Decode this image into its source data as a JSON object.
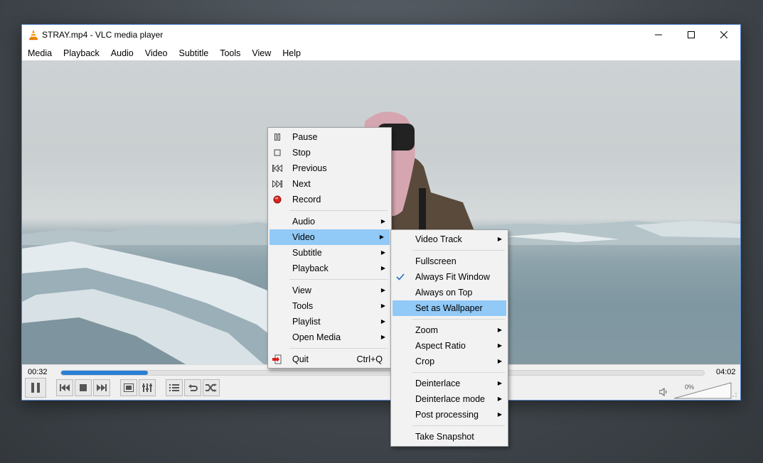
{
  "window": {
    "title": "STRAY.mp4 - VLC media player",
    "icon": "vlc-cone-icon"
  },
  "menubar": [
    "Media",
    "Playback",
    "Audio",
    "Video",
    "Subtitle",
    "Tools",
    "View",
    "Help"
  ],
  "player": {
    "elapsed": "00:32",
    "total": "04:02",
    "progress_fraction": 0.135,
    "volume_label": "0%",
    "accent_color": "#2a7fd4"
  },
  "context_menu": {
    "items": [
      {
        "label": "Pause",
        "icon": "pause-icon"
      },
      {
        "label": "Stop",
        "icon": "stop-icon"
      },
      {
        "label": "Previous",
        "icon": "previous-icon"
      },
      {
        "label": "Next",
        "icon": "next-icon"
      },
      {
        "label": "Record",
        "icon": "record-icon"
      },
      {
        "label": "Audio",
        "submenu": true
      },
      {
        "label": "Video",
        "submenu": true,
        "highlighted": true
      },
      {
        "label": "Subtitle",
        "submenu": true
      },
      {
        "label": "Playback",
        "submenu": true
      },
      {
        "label": "View",
        "submenu": true
      },
      {
        "label": "Tools",
        "submenu": true
      },
      {
        "label": "Playlist",
        "submenu": true
      },
      {
        "label": "Open Media",
        "submenu": true
      },
      {
        "label": "Quit",
        "icon": "quit-icon",
        "shortcut": "Ctrl+Q"
      }
    ]
  },
  "video_submenu": {
    "items": [
      {
        "label": "Video Track",
        "submenu": true
      },
      {
        "label": "Fullscreen"
      },
      {
        "label": "Always Fit Window",
        "checked": true
      },
      {
        "label": "Always on Top"
      },
      {
        "label": "Set as Wallpaper",
        "highlighted": true
      },
      {
        "label": "Zoom",
        "submenu": true
      },
      {
        "label": "Aspect Ratio",
        "submenu": true
      },
      {
        "label": "Crop",
        "submenu": true
      },
      {
        "label": "Deinterlace",
        "submenu": true
      },
      {
        "label": "Deinterlace mode",
        "submenu": true
      },
      {
        "label": "Post processing",
        "submenu": true
      },
      {
        "label": "Take Snapshot"
      }
    ]
  }
}
